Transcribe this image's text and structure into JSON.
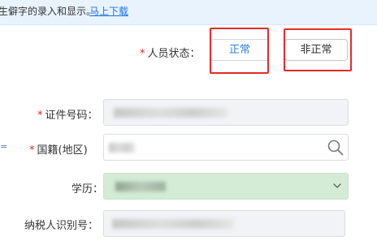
{
  "notice": {
    "text": "生僻字的录入和显示。",
    "link": "马上下载"
  },
  "form": {
    "status": {
      "label": "人员状态：",
      "required": "*",
      "options": [
        "正常",
        "非正常"
      ]
    },
    "id_number": {
      "label": "证件号码：",
      "required": "*"
    },
    "nationality": {
      "label": "国籍(地区)",
      "required": "*",
      "icon": "search-icon"
    },
    "education": {
      "label": "学历：",
      "icon": "chevron-down-icon"
    },
    "tax_id": {
      "label": "纳税人识别号："
    }
  },
  "edge_mark": "=",
  "colors": {
    "accent": "#2f7fe6",
    "required": "#e2231a",
    "highlight_box": "#e62a2a",
    "education_fill": "#d4ecd5",
    "notice_bg": "#e9f3fd"
  }
}
